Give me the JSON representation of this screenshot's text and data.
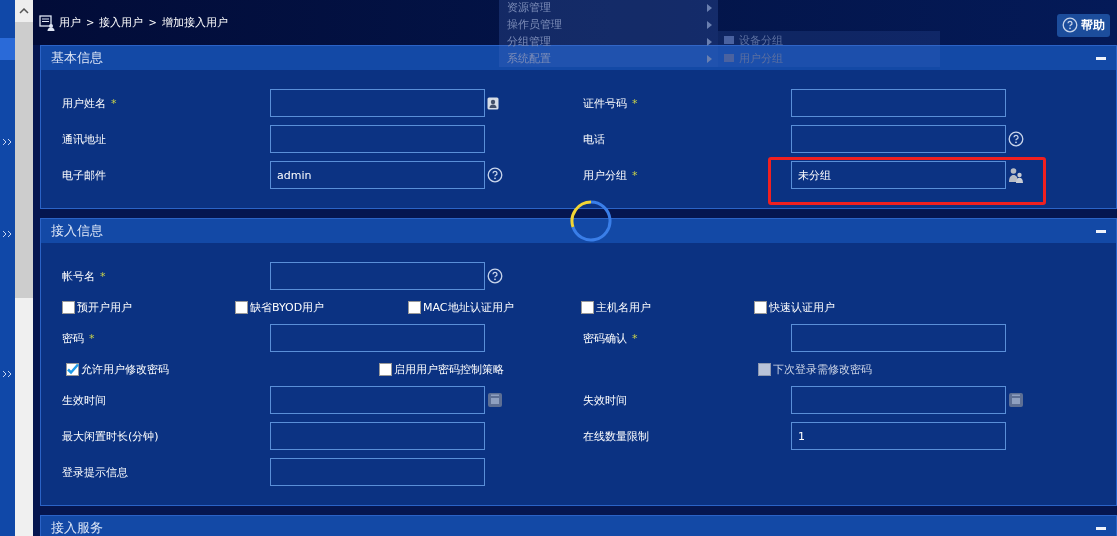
{
  "breadcrumb": {
    "items": [
      "用户",
      "接入用户",
      "增加接入用户"
    ],
    "separator": ">"
  },
  "help_button": {
    "label": "帮助"
  },
  "menu": {
    "items": [
      {
        "label": "资源管理"
      },
      {
        "label": "操作员管理"
      },
      {
        "label": "分组管理"
      },
      {
        "label": "系统配置"
      }
    ],
    "submenu": {
      "items": [
        {
          "label": "设备分组"
        },
        {
          "label": "用户分组"
        }
      ]
    }
  },
  "sections": [
    {
      "title": "基本信息",
      "rows": [
        {
          "kind": "fields",
          "fields": [
            {
              "label": "用户姓名",
              "mark": "*",
              "kind": "card"
            },
            {
              "label": "证件号码",
              "mark": "*",
              "kind": "plain"
            }
          ]
        },
        {
          "kind": "fields",
          "fields": [
            {
              "label": "通讯地址",
              "kind": "plain"
            },
            {
              "label": "电话",
              "kind": "help"
            }
          ]
        },
        {
          "kind": "fields",
          "fields": [
            {
              "label": "电子邮件",
              "kind": "help",
              "value": "admin"
            },
            {
              "label": "用户分组",
              "mark": "*",
              "kind": "group",
              "value": "未分组",
              "highlighted": true
            }
          ]
        }
      ]
    },
    {
      "title": "接入信息",
      "rows": [
        {
          "kind": "fields",
          "fields": [
            {
              "label": "帐号名",
              "mark": "*",
              "kind": "help"
            }
          ]
        },
        {
          "kind": "checkboxes",
          "items": [
            {
              "label": "预开户用户",
              "checked": false,
              "disabled": false
            },
            {
              "label": "缺省BYOD用户",
              "checked": false,
              "disabled": false
            },
            {
              "label": "MAC地址认证用户",
              "checked": false,
              "disabled": false
            },
            {
              "label": "主机名用户",
              "checked": false,
              "disabled": false
            },
            {
              "label": "快速认证用户",
              "checked": false,
              "disabled": false
            }
          ]
        },
        {
          "kind": "fields",
          "fields": [
            {
              "label": "密码",
              "mark": "*",
              "kind": "plain"
            },
            {
              "label": "密码确认",
              "mark": "*",
              "kind": "plain"
            }
          ]
        },
        {
          "kind": "checkboxes",
          "items": [
            {
              "label": "允许用户修改密码",
              "checked": true,
              "disabled": false
            },
            {
              "label": "启用用户密码控制策略",
              "checked": false,
              "disabled": false
            },
            {
              "label": "下次登录需修改密码",
              "checked": false,
              "disabled": true
            }
          ]
        },
        {
          "kind": "fields",
          "fields": [
            {
              "label": "生效时间",
              "kind": "date"
            },
            {
              "label": "失效时间",
              "kind": "date"
            }
          ]
        },
        {
          "kind": "fields",
          "fields": [
            {
              "label": "最大闲置时长(分钟)",
              "kind": "plain"
            },
            {
              "label": "在线数量限制",
              "kind": "plain",
              "value": "1"
            }
          ]
        },
        {
          "kind": "fields",
          "fields": [
            {
              "label": "登录提示信息",
              "kind": "plain"
            }
          ]
        }
      ]
    },
    {
      "title": "接入服务"
    }
  ]
}
